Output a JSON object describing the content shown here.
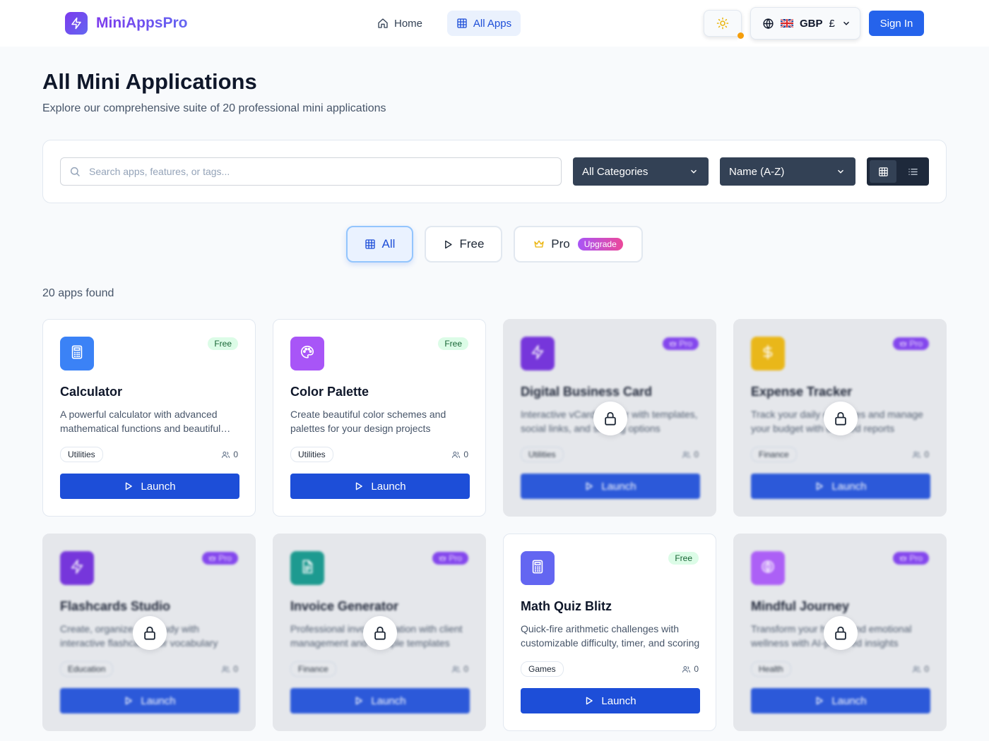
{
  "header": {
    "brand": "MiniAppsPro",
    "nav": {
      "home": "Home",
      "all_apps": "All Apps"
    },
    "currency": {
      "code": "GBP",
      "symbol": "£"
    },
    "sign_in": "Sign In"
  },
  "page": {
    "title": "All Mini Applications",
    "subtitle": "Explore our comprehensive suite of 20 professional mini applications"
  },
  "filters": {
    "search_placeholder": "Search apps, features, or tags...",
    "category": "All Categories",
    "sort": "Name (A-Z)"
  },
  "tiers": {
    "all": "All",
    "free": "Free",
    "pro": "Pro",
    "upgrade": "Upgrade"
  },
  "results": {
    "count_text": "20 apps found"
  },
  "badges": {
    "free": "Free",
    "pro": "Pro"
  },
  "launch_label": "Launch",
  "apps": [
    {
      "title": "Calculator",
      "desc": "A powerful calculator with advanced mathematical functions and beautiful interface",
      "tag": "Utilities",
      "users": "0",
      "tier": "Free",
      "icon": "calculator-icon",
      "color": "#3b82f6"
    },
    {
      "title": "Color Palette",
      "desc": "Create beautiful color schemes and palettes for your design projects",
      "tag": "Utilities",
      "users": "0",
      "tier": "Free",
      "icon": "palette-icon",
      "color": "#a855f7"
    },
    {
      "title": "Digital Business Card",
      "desc": "Interactive vCard creator with templates, social links, and sharing options",
      "tag": "Utilities",
      "users": "0",
      "tier": "Pro",
      "icon": "lightning-icon",
      "color": "#6d28d9"
    },
    {
      "title": "Expense Tracker",
      "desc": "Track your daily expenses and manage your budget with detailed reports",
      "tag": "Finance",
      "users": "0",
      "tier": "Pro",
      "icon": "dollar-icon",
      "color": "#eab308"
    },
    {
      "title": "Flashcards Studio",
      "desc": "Create, organize and study with interactive flashcards for vocabulary",
      "tag": "Education",
      "users": "0",
      "tier": "Pro",
      "icon": "lightning-icon",
      "color": "#6d28d9"
    },
    {
      "title": "Invoice Generator",
      "desc": "Professional invoice creation with client management and multiple templates",
      "tag": "Finance",
      "users": "0",
      "tier": "Pro",
      "icon": "document-icon",
      "color": "#0d9488"
    },
    {
      "title": "Math Quiz Blitz",
      "desc": "Quick-fire arithmetic challenges with customizable difficulty, timer, and scoring",
      "tag": "Games",
      "users": "0",
      "tier": "Free",
      "icon": "calculator-icon",
      "color": "#6366f1"
    },
    {
      "title": "Mindful Journey",
      "desc": "Transform your habits and emotional wellness with AI-powered insights",
      "tag": "Health",
      "users": "0",
      "tier": "Pro",
      "icon": "brain-icon",
      "color": "#a855f7"
    }
  ]
}
